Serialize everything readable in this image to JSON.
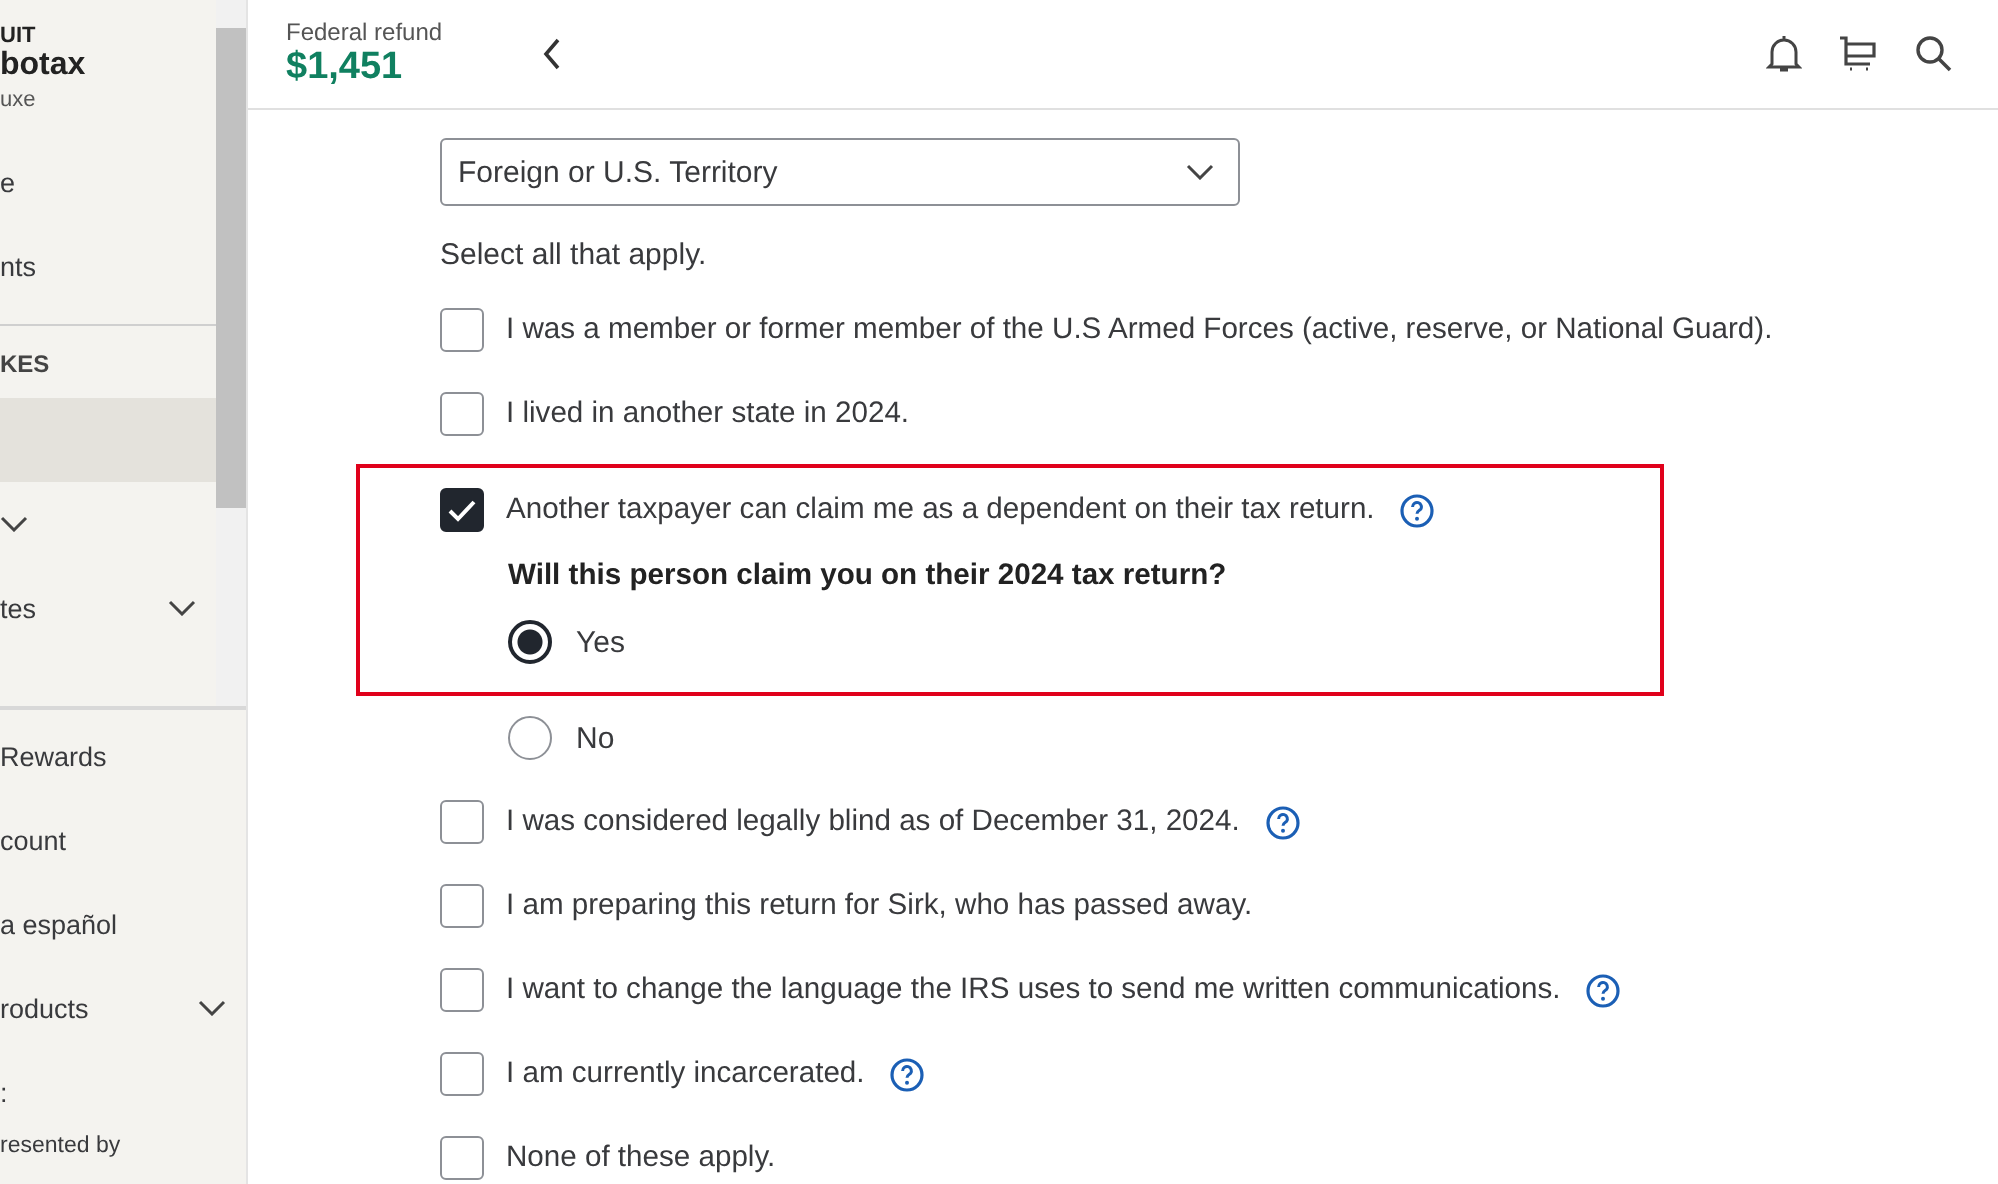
{
  "sidebar": {
    "brand": {
      "line1": "UIT",
      "line2": "botax",
      "line3": "uxe"
    },
    "top_items": [
      {
        "label": "e"
      },
      {
        "label": "nts"
      }
    ],
    "section_label": "KES",
    "section_items": [
      {
        "selected": true,
        "expandable": false
      },
      {
        "selected": false,
        "expandable": true
      },
      {
        "label": "tes",
        "selected": false,
        "expandable": true
      }
    ],
    "lower_items": [
      {
        "label": "Rewards",
        "expandable": false
      },
      {
        "label": "count",
        "expandable": false
      },
      {
        "label": "a español",
        "expandable": false
      },
      {
        "label": "roducts",
        "expandable": true
      },
      {
        "label": ":",
        "expandable": false
      }
    ],
    "footer": "resented by"
  },
  "header": {
    "refund_label": "Federal refund",
    "refund_amount": "$1,451"
  },
  "form": {
    "dropdown": {
      "value": "Foreign or U.S. Territory"
    },
    "instruction": "Select all that apply.",
    "options": [
      {
        "label": "I was a member or former member of the U.S Armed Forces (active, reserve, or National Guard).",
        "checked": false,
        "help": false
      },
      {
        "label": "I lived in another state in 2024.",
        "checked": false,
        "help": false
      },
      {
        "label": "Another taxpayer can claim me as a dependent on their tax return.",
        "checked": true,
        "help": true,
        "highlighted": true,
        "follow_up": {
          "question": "Will this person claim you on their 2024 tax return?",
          "choices": [
            {
              "label": "Yes",
              "selected": true
            },
            {
              "label": "No",
              "selected": false
            }
          ]
        }
      },
      {
        "label": "I was considered legally blind as of December 31, 2024.",
        "checked": false,
        "help": true
      },
      {
        "label": "I am preparing this return for Sirk, who has passed away.",
        "checked": false,
        "help": false
      },
      {
        "label": "I want to change the language the IRS uses to send me written communications.",
        "checked": false,
        "help": true
      },
      {
        "label": "I am currently incarcerated.",
        "checked": false,
        "help": true
      },
      {
        "label": "None of these apply.",
        "checked": false,
        "help": false
      }
    ]
  }
}
